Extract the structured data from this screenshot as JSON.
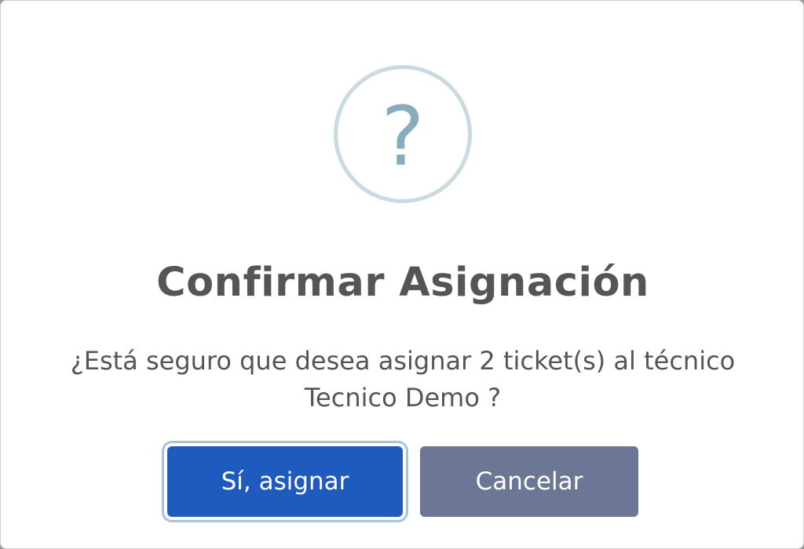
{
  "dialog": {
    "icon": "question-mark-icon",
    "icon_glyph": "?",
    "title": "Confirmar Asignación",
    "message_line1": "¿Está seguro que desea asignar 2 ticket(s) al técnico",
    "message_line2": "Tecnico Demo ?",
    "confirm_label": "Sí, asignar",
    "cancel_label": "Cancelar"
  },
  "colors": {
    "confirm_button": "#1f5bbf",
    "cancel_button": "#6b7794",
    "icon_ring": "#c9dae1",
    "icon_glyph": "#87adbd",
    "text": "#555555"
  }
}
